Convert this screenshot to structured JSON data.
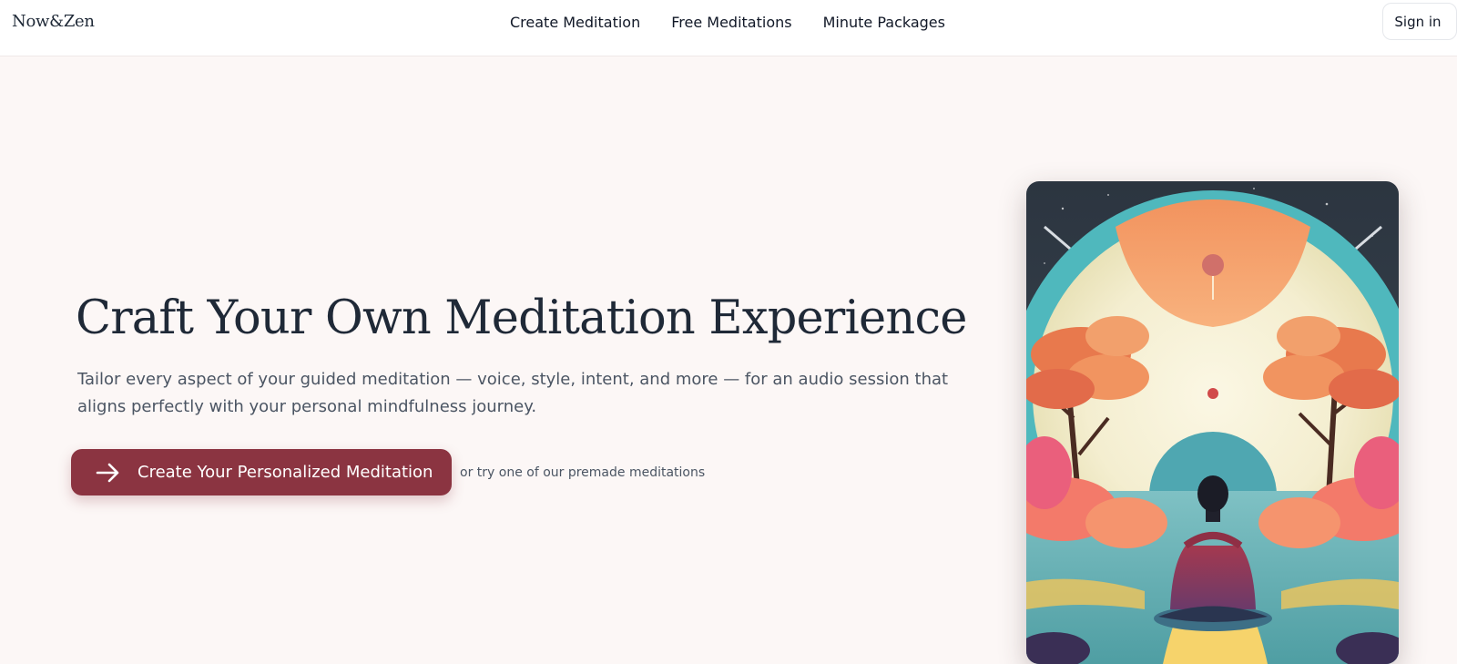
{
  "header": {
    "logo": "Now&Zen",
    "nav": [
      {
        "label": "Create Meditation"
      },
      {
        "label": "Free Meditations"
      },
      {
        "label": "Minute Packages"
      }
    ],
    "sign_in_label": "Sign in"
  },
  "hero": {
    "title": "Craft Your Own Meditation Experience",
    "subtitle": "Tailor every aspect of your guided meditation — voice, style, intent, and more — for an audio session that aligns perfectly with your personal mindfulness journey.",
    "cta_label": "Create Your Personalized Meditation",
    "cta_icon": "arrow-right-icon",
    "alt_link": "or try one of our premade meditations"
  },
  "illustration": {
    "name": "meditating-person-illustration"
  },
  "colors": {
    "accent": "#8b3441",
    "background": "#fcf7f6",
    "text": "#1f2937",
    "muted_text": "#4b5563"
  }
}
